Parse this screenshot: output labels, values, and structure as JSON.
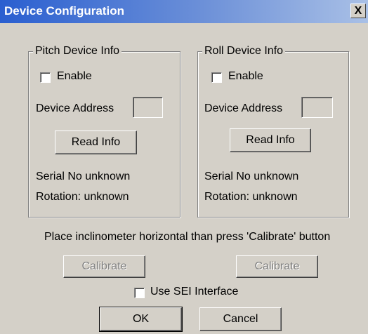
{
  "window": {
    "title": "Device Configuration",
    "close_glyph": "X"
  },
  "pitch": {
    "group_label": "Pitch Device Info",
    "enable_label": "Enable",
    "enable_checked": false,
    "address_label": "Device Address",
    "address_value": "",
    "read_info_label": "Read Info",
    "serial_text": "Serial No unknown",
    "rotation_text": "Rotation: unknown"
  },
  "roll": {
    "group_label": "Roll Device Info",
    "enable_label": "Enable",
    "enable_checked": false,
    "address_label": "Device Address",
    "address_value": "",
    "read_info_label": "Read Info",
    "serial_text": "Serial No unknown",
    "rotation_text": "Rotation: unknown"
  },
  "instruction_text": "Place inclinometer horizontal than press 'Calibrate' button",
  "calibrate_pitch_label": "Calibrate",
  "calibrate_roll_label": "Calibrate",
  "use_sei": {
    "label": "Use SEI Interface",
    "checked": false
  },
  "ok_label": "OK",
  "cancel_label": "Cancel",
  "colors": {
    "titlebar_start": "#2a5fd0",
    "titlebar_end": "#a9c0e6",
    "face": "#d4d0c8"
  }
}
